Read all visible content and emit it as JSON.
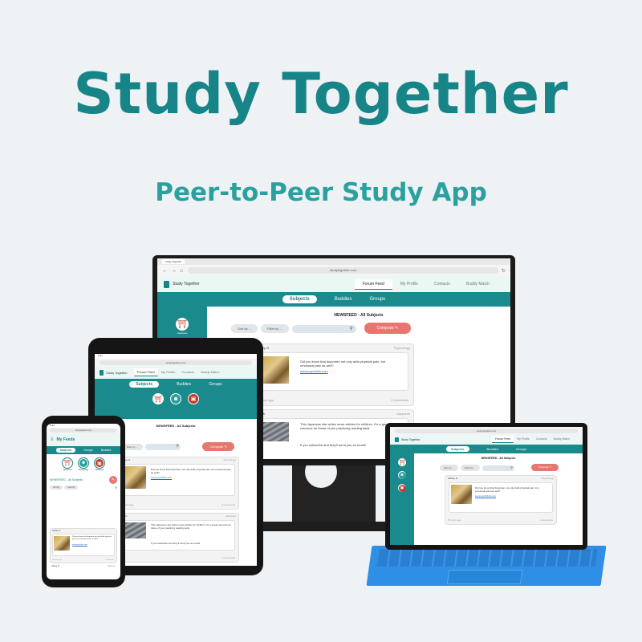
{
  "hero": {
    "title": "Study Together",
    "subtitle": "Peer-to-Peer Study App"
  },
  "colors": {
    "brand": "#178587",
    "accent": "#2aa19e",
    "compose": "#e8756f"
  },
  "app": {
    "tab_title": "Study Together",
    "url": "studytogether.com",
    "brand": "Study Together",
    "nav": [
      "Forum Feed",
      "My Profile",
      "Contacts",
      "Buddy Match"
    ],
    "subnav": [
      "Subjects",
      "Buddies",
      "Groups"
    ],
    "newsfeed_title": "NEWSFEED - All Subjects",
    "sort_label": "Sort by ...",
    "filter_label": "Filter by ...",
    "compose_label": "Compose",
    "phone_feed_title": "My Feeds",
    "phone_sort": "Sort By",
    "phone_filter": "Filter By",
    "subject_icons": [
      "Japanese",
      "Psychology",
      "Business"
    ],
    "posts": [
      {
        "author": "Ashley G.",
        "subject": "Psychology",
        "text": "Did you know that ibuprofen not only dulls physical pain, but emotional pain as well?",
        "link": "www.psychlink.com",
        "time": "35 mins ago",
        "comments": "2 comments"
      },
      {
        "author": "Yuki K.",
        "subject": "Japanese",
        "text": "This Japanese site writes news articles for children. It's a great resource for those of you practicing reading kanji.",
        "extra": "If you subscribe and they'll send you an email!",
        "comments": "3 comments"
      }
    ],
    "phone_third_author": "Casey H.",
    "phone_third_subject": "Japanese"
  }
}
